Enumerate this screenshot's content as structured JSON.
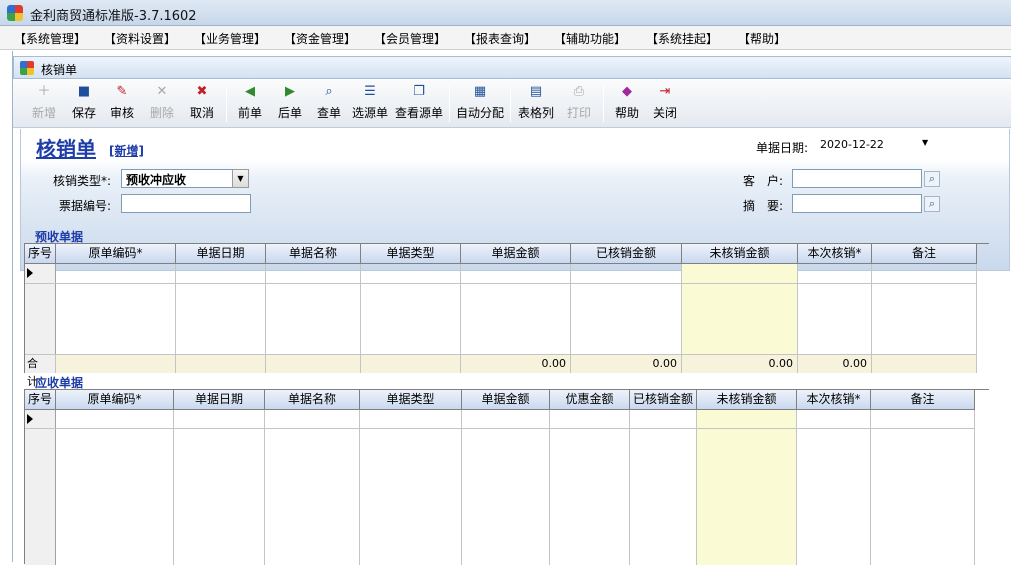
{
  "window": {
    "title": "金利商贸通标准版-3.7.1602"
  },
  "menu": [
    "【系统管理】",
    "【资料设置】",
    "【业务管理】",
    "【资金管理】",
    "【会员管理】",
    "【报表查询】",
    "【辅助功能】",
    "【系统挂起】",
    "【帮助】"
  ],
  "child_window": {
    "title": "核销单"
  },
  "toolbar": {
    "new": "新增",
    "save": "保存",
    "audit": "审核",
    "delete": "删除",
    "cancel": "取消",
    "prev": "前单",
    "next": "后单",
    "query": "查单",
    "select_source": "选源单",
    "view_source": "查看源单",
    "auto_allocate": "自动分配",
    "grid_columns": "表格列",
    "print": "打印",
    "help": "帮助",
    "close": "关闭"
  },
  "header": {
    "title": "核销单",
    "status": "[新增]",
    "date_label": "单据日期:",
    "date_value": "2020-12-22",
    "type_label": "核销类型*:",
    "type_value": "预收冲应收",
    "ticket_label": "票据编号:",
    "ticket_value": "",
    "customer_label": "客　户:",
    "customer_value": "",
    "summary_label": "摘　要:",
    "summary_value": ""
  },
  "prepaid": {
    "title": "预收单据",
    "columns": [
      "序号",
      "原单编码*",
      "单据日期",
      "单据名称",
      "单据类型",
      "单据金额",
      "已核销金额",
      "未核销金额",
      "本次核销*",
      "备注"
    ],
    "total_label": "合计:",
    "totals": [
      "0.00",
      "0.00",
      "0.00",
      "0.00"
    ]
  },
  "receivable": {
    "title": "应收单据",
    "columns": [
      "序号",
      "原单编码*",
      "单据日期",
      "单据名称",
      "单据类型",
      "单据金额",
      "优惠金额",
      "已核销金额",
      "未核销金额",
      "本次核销*",
      "备注"
    ]
  }
}
